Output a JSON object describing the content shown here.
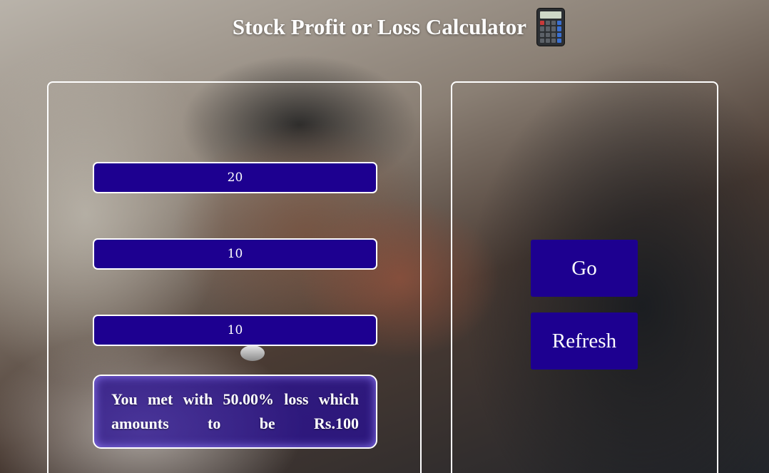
{
  "header": {
    "title": "Stock Profit or Loss Calculator",
    "icon": "calculator-icon"
  },
  "form": {
    "inputs": [
      {
        "value": "20"
      },
      {
        "value": "10"
      },
      {
        "value": "10"
      }
    ],
    "output": "You met with 50.00% loss which amounts to be Rs.100"
  },
  "actions": {
    "go_label": "Go",
    "refresh_label": "Refresh"
  },
  "colors": {
    "accent": "#1d0090",
    "border": "#ffffff",
    "text": "#ffffff"
  }
}
